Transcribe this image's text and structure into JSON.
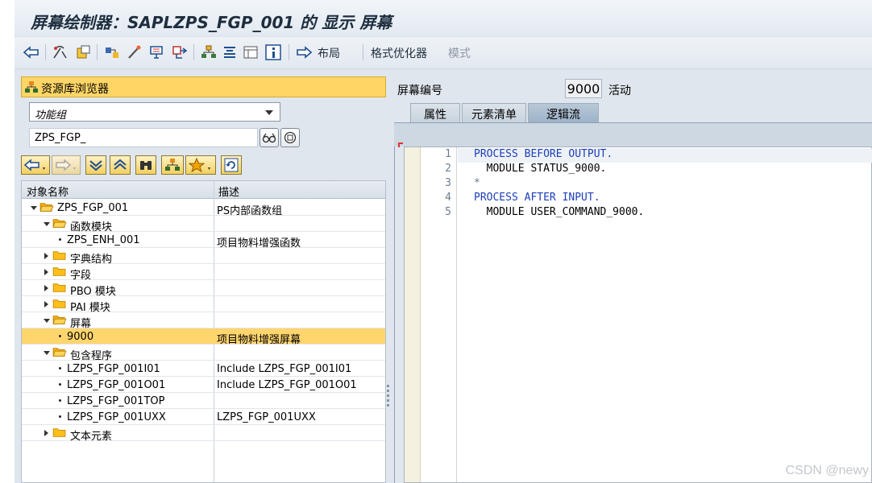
{
  "window": {
    "title": "屏幕绘制器：SAPLZPS_FGP_001 的 显示 屏幕"
  },
  "toolbar": {
    "layout_label": "布局",
    "formatter_label": "格式优化器",
    "mode_label": "模式"
  },
  "left_pane": {
    "repository_browser_label": "资源库浏览器",
    "object_type_value": "功能组",
    "object_name_value": "ZPS_FGP_",
    "columns": [
      "对象名称",
      "描述"
    ],
    "tree": [
      {
        "name": "ZPS_FGP_001",
        "desc": "PS内部函数组",
        "kind": "folder",
        "state": "expanded",
        "level": 0
      },
      {
        "name": "函数模块",
        "desc": "",
        "kind": "folder",
        "state": "expanded",
        "level": 1
      },
      {
        "name": "ZPS_ENH_001",
        "desc": "项目物料增强函数",
        "kind": "leaf",
        "level": 2
      },
      {
        "name": "字典结构",
        "desc": "",
        "kind": "folder",
        "state": "collapsed",
        "level": 1
      },
      {
        "name": "字段",
        "desc": "",
        "kind": "folder",
        "state": "collapsed",
        "level": 1
      },
      {
        "name": "PBO 模块",
        "desc": "",
        "kind": "folder",
        "state": "collapsed",
        "level": 1
      },
      {
        "name": "PAI 模块",
        "desc": "",
        "kind": "folder",
        "state": "collapsed",
        "level": 1
      },
      {
        "name": "屏幕",
        "desc": "",
        "kind": "folder",
        "state": "expanded",
        "level": 1
      },
      {
        "name": "9000",
        "desc": "项目物料增强屏幕",
        "kind": "leaf",
        "level": 2,
        "selected": true
      },
      {
        "name": "包含程序",
        "desc": "",
        "kind": "folder",
        "state": "expanded",
        "level": 1
      },
      {
        "name": "LZPS_FGP_001I01",
        "desc": "Include LZPS_FGP_001I01",
        "kind": "leaf",
        "level": 2
      },
      {
        "name": "LZPS_FGP_001O01",
        "desc": "Include LZPS_FGP_001O01",
        "kind": "leaf",
        "level": 2
      },
      {
        "name": "LZPS_FGP_001TOP",
        "desc": "",
        "kind": "leaf",
        "level": 2
      },
      {
        "name": "LZPS_FGP_001UXX",
        "desc": "LZPS_FGP_001UXX",
        "kind": "leaf",
        "level": 2
      },
      {
        "name": "文本元素",
        "desc": "",
        "kind": "folder",
        "state": "collapsed",
        "level": 1
      }
    ]
  },
  "right_pane": {
    "screen_number_label": "屏幕编号",
    "screen_number_value": "9000",
    "status": "活动",
    "tabs": [
      "属性",
      "元素清单",
      "逻辑流"
    ],
    "active_tab": "逻辑流",
    "code": [
      {
        "num": "1",
        "text": "PROCESS BEFORE OUTPUT.",
        "style": "kw"
      },
      {
        "num": "2",
        "text": "  MODULE STATUS_9000.",
        "style": "plain"
      },
      {
        "num": "3",
        "text": "*",
        "style": "comment"
      },
      {
        "num": "4",
        "text": "PROCESS AFTER INPUT.",
        "style": "kw"
      },
      {
        "num": "5",
        "text": "  MODULE USER_COMMAND_9000.",
        "style": "plain"
      }
    ]
  },
  "watermark": "CSDN @newy",
  "colors": {
    "selection": "#ffd56e",
    "keyword": "#1c3fb8",
    "folder": "#ffc020"
  }
}
